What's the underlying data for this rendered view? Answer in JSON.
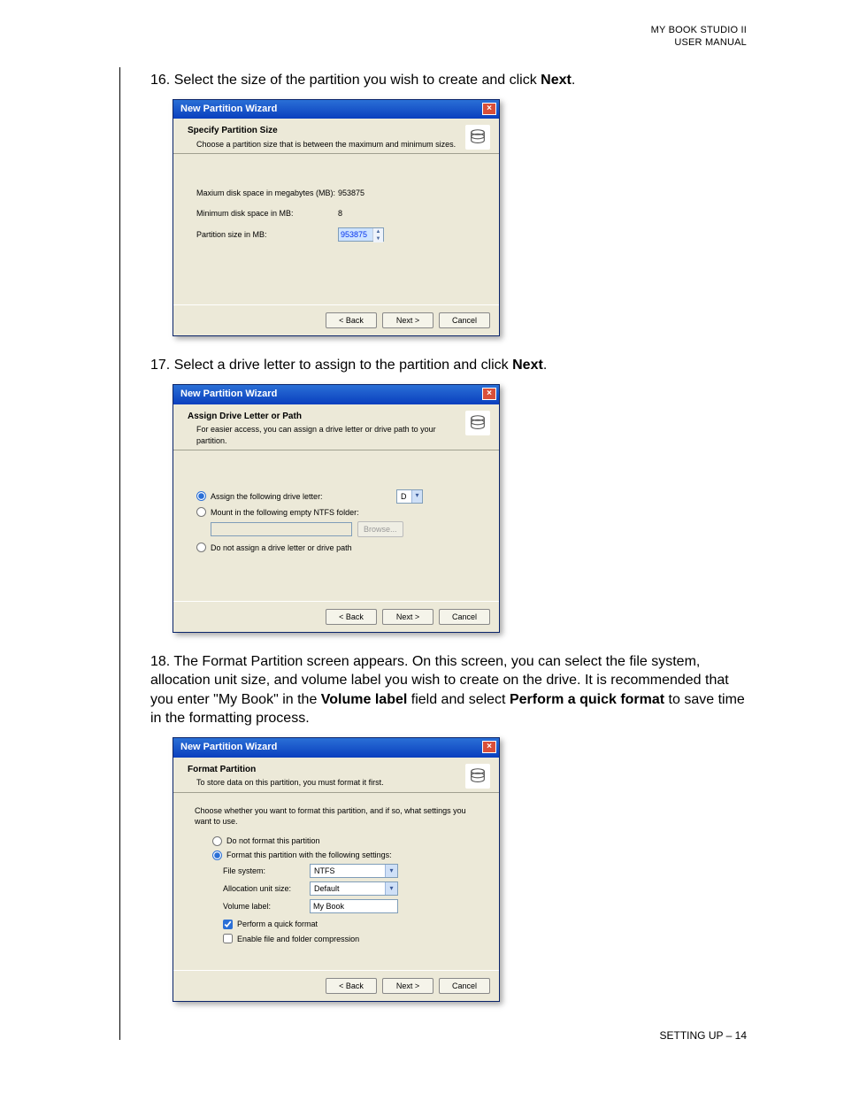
{
  "header": {
    "line1": "MY BOOK STUDIO II",
    "line2": "USER MANUAL"
  },
  "steps": {
    "s16": {
      "num": "16.",
      "t1": "Select the size of the partition you wish to create and click ",
      "b1": "Next",
      "t2": "."
    },
    "s17": {
      "num": "17.",
      "t1": "Select a drive letter to assign to the partition and click ",
      "b1": "Next",
      "t2": "."
    },
    "s18": {
      "num": "18.",
      "t1": "The Format Partition screen appears. On this screen, you can select the file system, allocation unit size, and volume label you wish to create on the drive. It is recommended that you enter \"My Book\" in the ",
      "b1": "Volume label",
      "t2": " field and select ",
      "b2": "Perform a quick format",
      "t3": " to save time in the formatting process."
    }
  },
  "common": {
    "title": "New Partition Wizard",
    "back": "< Back",
    "next": "Next >",
    "cancel": "Cancel"
  },
  "d1": {
    "headTitle": "Specify Partition Size",
    "headSub": "Choose a partition size that is between the maximum and minimum sizes.",
    "maxLabel": "Maxium disk space in megabytes (MB):",
    "maxValue": "953875",
    "minLabel": "Minimum disk space in MB:",
    "minValue": "8",
    "sizeLabel": "Partition size in MB:",
    "sizeValue": "953875"
  },
  "d2": {
    "headTitle": "Assign Drive Letter or Path",
    "headSub": "For easier access, you can assign a drive letter or drive path to your partition.",
    "opt1": "Assign the following drive letter:",
    "driveLetter": "D",
    "opt2": "Mount in the following empty NTFS folder:",
    "browse": "Browse...",
    "opt3": "Do not assign a drive letter or drive path"
  },
  "d3": {
    "headTitle": "Format Partition",
    "headSub": "To store data on this partition, you must format it first.",
    "intro": "Choose whether you want to format this partition, and if so, what settings you want to use.",
    "opt1": "Do not format this partition",
    "opt2": "Format this partition with the following settings:",
    "fsLabel": "File system:",
    "fsValue": "NTFS",
    "ausLabel": "Allocation unit size:",
    "ausValue": "Default",
    "volLabel": "Volume label:",
    "volValue": "My Book",
    "chk1": "Perform a quick format",
    "chk2": "Enable file and folder compression"
  },
  "footer": "SETTING UP – 14"
}
